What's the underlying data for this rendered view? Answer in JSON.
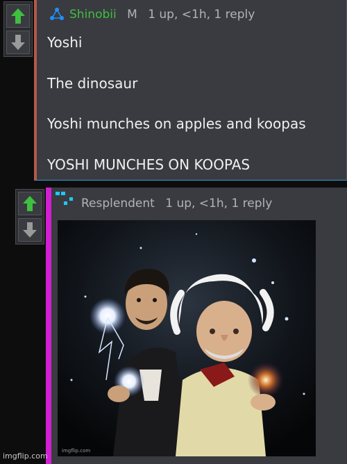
{
  "comment1": {
    "username": "Shinobii",
    "mod_badge": "M",
    "meta": "1 up, <1h, 1 reply",
    "lines": [
      "Yoshi",
      "The dinosaur",
      "Yoshi munches on apples and koopas",
      "YOSHI MUNCHES ON KOOPAS"
    ]
  },
  "comment2": {
    "username": "Resplendent",
    "meta": "1 up, <1h, 1 reply",
    "image_watermark": "imgflip.com"
  },
  "footer_watermark": "imgflip.com",
  "colors": {
    "upvote": "#3fbf3f",
    "downvote": "#9a9a9a",
    "accent_green": "#3fbf3f",
    "accent_magenta": "#d11fd1",
    "accent_blue": "#1e90ff"
  }
}
